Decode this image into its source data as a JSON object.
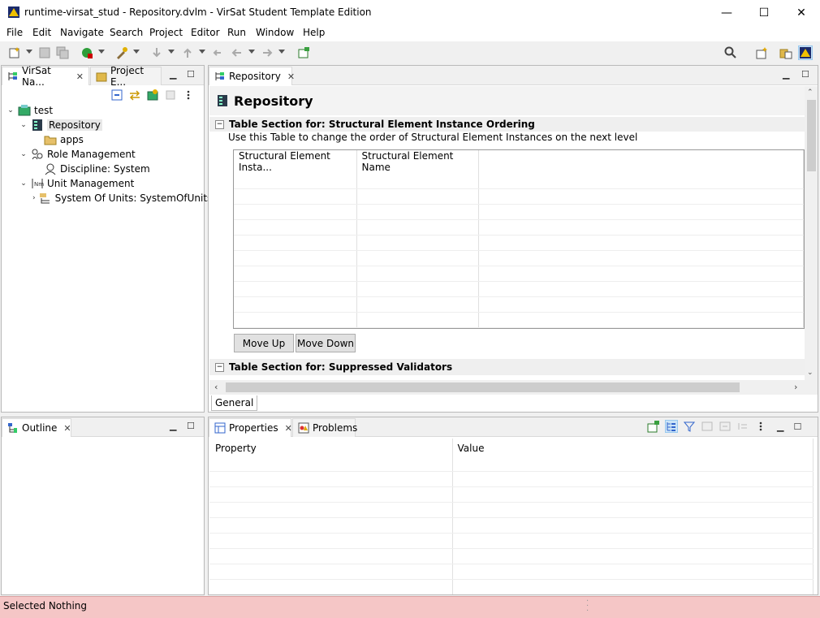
{
  "window": {
    "title": "runtime-virsat_stud - Repository.dvlm - VirSat Student Template Edition",
    "minimize": "—",
    "maximize": "☐",
    "close": "✕"
  },
  "menu": [
    "File",
    "Edit",
    "Navigate",
    "Search",
    "Project",
    "Editor",
    "Run",
    "Window",
    "Help"
  ],
  "left_panel": {
    "tabs": [
      {
        "label": "VirSat Na..."
      },
      {
        "label": "Project E..."
      }
    ],
    "tree": {
      "root": "test",
      "repository": "Repository",
      "apps": "apps",
      "role_management": "Role Management",
      "discipline": "Discipline: System",
      "unit_management": "Unit Management",
      "system_of_units": "System Of Units: SystemOfUnits"
    }
  },
  "editor": {
    "tab": "Repository",
    "header": "Repository",
    "section1": {
      "title": "Table Section for: Structural Element Instance Ordering",
      "description": "Use this Table to change the order of Structural Element Instances on the next level",
      "columns": [
        "Structural Element Insta...",
        "Structural Element Name"
      ],
      "move_up": "Move Up",
      "move_down": "Move Down"
    },
    "section2": {
      "title": "Table Section for: Suppressed Validators"
    },
    "bottom_tab": "General"
  },
  "outline": {
    "tab": "Outline"
  },
  "properties": {
    "tabs": [
      {
        "label": "Properties"
      },
      {
        "label": "Problems"
      }
    ],
    "columns": [
      "Property",
      "Value"
    ]
  },
  "status": {
    "text": "Selected Nothing"
  },
  "colors": {
    "status_bg": "#f5c6c6",
    "selection": "#e8e8e8"
  }
}
